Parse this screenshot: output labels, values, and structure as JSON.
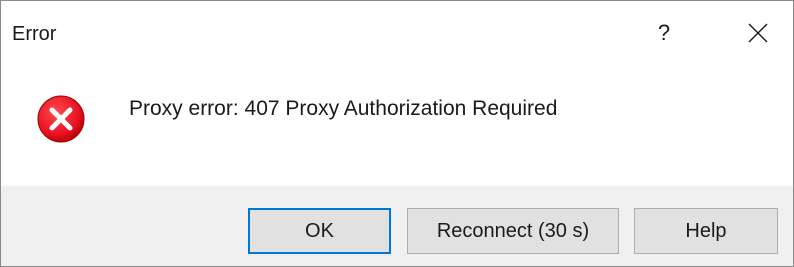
{
  "window": {
    "title": "Error",
    "help_label": "?",
    "close_icon": "close-icon"
  },
  "content": {
    "icon": "error-icon",
    "icon_color": "#e81123",
    "message": "Proxy error: 407 Proxy Authorization Required"
  },
  "buttons": {
    "ok_label": "OK",
    "reconnect_label": "Reconnect (30 s)",
    "help_label": "Help"
  },
  "colors": {
    "default_button_border": "#0078d7",
    "footer_background": "#f0f0f0"
  }
}
